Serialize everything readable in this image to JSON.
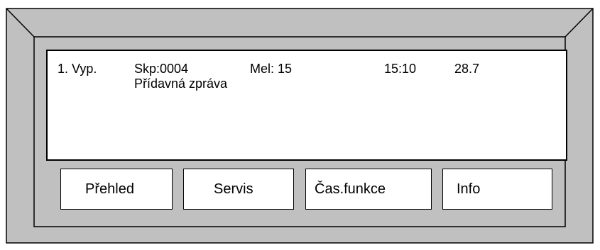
{
  "display": {
    "line1": {
      "state": "1. Vyp.",
      "group": "Skp:0004",
      "detector": "Mel: 15",
      "time": "15:10",
      "date": "28.7"
    },
    "line2": {
      "message": "Přídavná zpráva"
    }
  },
  "softkeys": {
    "overview": "Přehled",
    "service": "Servis",
    "time_functions": "Čas.funkce",
    "info": "Info"
  },
  "colors": {
    "panel": "#c0c0c0",
    "screen": "#ffffff",
    "outline": "#000000"
  }
}
